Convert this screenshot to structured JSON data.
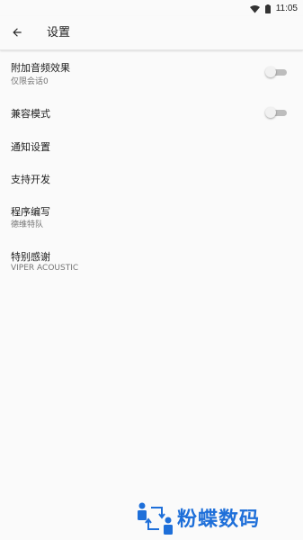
{
  "status_bar": {
    "time": "11:05",
    "wifi_icon": "wifi-icon",
    "battery_icon": "battery-icon"
  },
  "toolbar": {
    "back_icon": "arrow-back-icon",
    "title": "设置"
  },
  "items": [
    {
      "title": "附加音频效果",
      "summary": "仅限会话0",
      "switch": {
        "checked": false
      }
    },
    {
      "title": "兼容模式",
      "switch": {
        "checked": false
      }
    },
    {
      "title": "通知设置"
    },
    {
      "title": "支持开发"
    },
    {
      "title": "程序编写",
      "summary": "德维特队"
    },
    {
      "title": "特别感谢",
      "summary": "VIPER ACOUSTIC"
    }
  ],
  "watermark": {
    "text": "粉蝶数码"
  },
  "colors": {
    "background": "#fafafa",
    "switch_track_off": "#bdbdbd",
    "switch_thumb_off": "#f1f1f1",
    "watermark_blue": "#1e6fd9"
  }
}
